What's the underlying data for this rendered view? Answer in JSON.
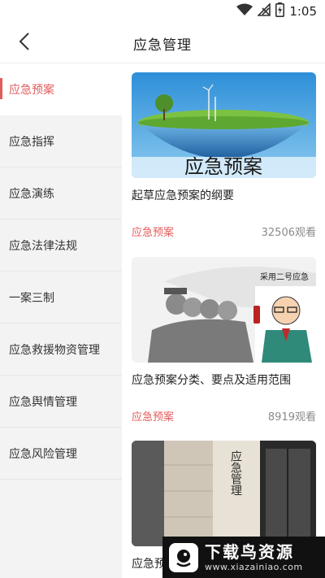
{
  "status_bar": {
    "time": "1:05",
    "icons": [
      "wifi-icon",
      "no-signal-icon",
      "battery-charging-icon"
    ]
  },
  "header": {
    "title": "应急管理",
    "back_icon": "chevron-left-icon"
  },
  "sidebar": {
    "items": [
      {
        "label": "应急预案",
        "active": true
      },
      {
        "label": "应急指挥",
        "active": false
      },
      {
        "label": "应急演练",
        "active": false
      },
      {
        "label": "应急法律法规",
        "active": false
      },
      {
        "label": "一案三制",
        "active": false
      },
      {
        "label": "应急救援物资管理",
        "active": false
      },
      {
        "label": "应急舆情管理",
        "active": false
      },
      {
        "label": "应急风险管理",
        "active": false
      }
    ]
  },
  "articles": [
    {
      "title": "起草应急预案的纲要",
      "tag": "应急预案",
      "views": "32506观看",
      "image_text": "应急预案"
    },
    {
      "title": "应急预案分类、要点及适用范围",
      "tag": "应急预案",
      "views": "8919观看",
      "image_text": "采用二号应急"
    },
    {
      "title": "应急预",
      "tag": "",
      "views": "",
      "image_text": "应急管理"
    }
  ],
  "watermark": {
    "title": "下载鸟资源",
    "url": "www.xiazainiao.com"
  },
  "colors": {
    "accent": "#e35b5b",
    "sidebar_bg": "#f3f3f3",
    "muted_text": "#8a8a8a"
  }
}
